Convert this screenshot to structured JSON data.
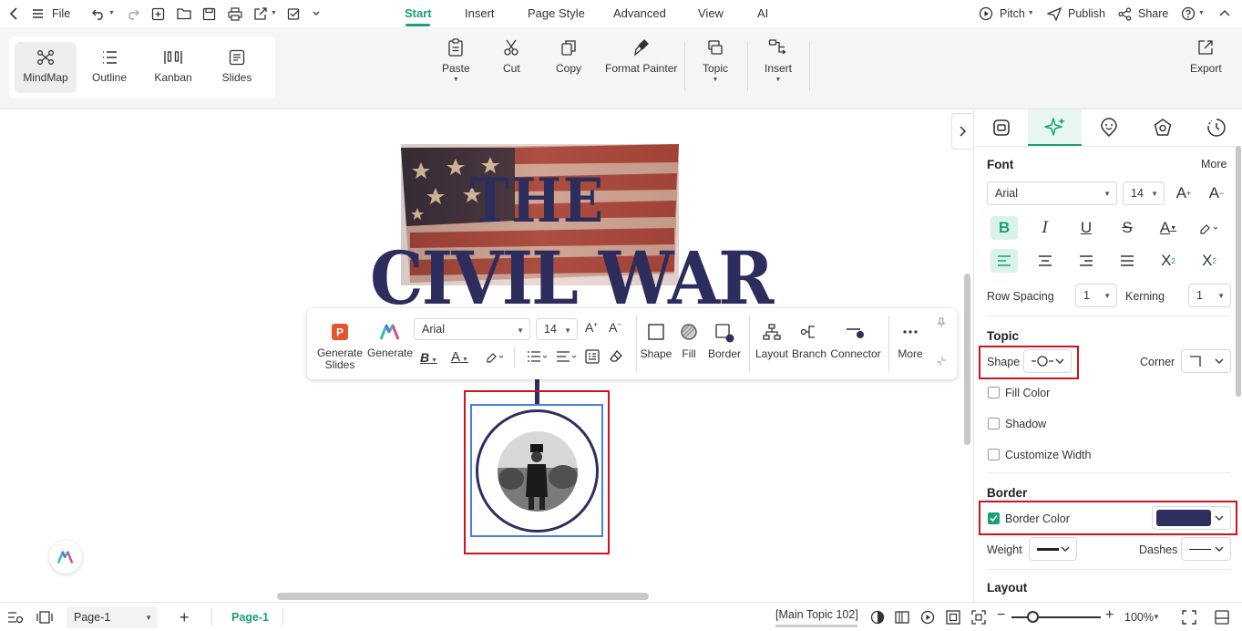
{
  "topbar": {
    "file_label": "File",
    "tabs": [
      {
        "label": "Start",
        "active": true
      },
      {
        "label": "Insert"
      },
      {
        "label": "Page Style"
      },
      {
        "label": "Advanced"
      },
      {
        "label": "View"
      },
      {
        "label": "AI"
      }
    ],
    "pitch_label": "Pitch",
    "publish_label": "Publish",
    "share_label": "Share"
  },
  "ribbon": {
    "views": [
      {
        "label": "MindMap",
        "icon": "mindmap-icon",
        "active": true
      },
      {
        "label": "Outline",
        "icon": "outline-icon"
      },
      {
        "label": "Kanban",
        "icon": "kanban-icon"
      },
      {
        "label": "Slides",
        "icon": "slides-icon"
      }
    ],
    "paste_label": "Paste",
    "cut_label": "Cut",
    "copy_label": "Copy",
    "format_painter_label": "Format Painter",
    "topic_label": "Topic",
    "insert_label": "Insert",
    "export_label": "Export"
  },
  "canvas": {
    "title_line1": "THE",
    "title_line2": "CIVIL WAR"
  },
  "floating_toolbar": {
    "generate_slides_label1": "Generate",
    "generate_slides_label2": "Slides",
    "generate_label": "Generate",
    "font": "Arial",
    "font_size": "14",
    "shape_label": "Shape",
    "fill_label": "Fill",
    "border_label": "Border",
    "layout_label": "Layout",
    "branch_label": "Branch",
    "connector_label": "Connector",
    "more_label": "More",
    "accent": "#2e2f5e"
  },
  "panel": {
    "font_title": "Font",
    "more_label": "More",
    "font_family": "Arial",
    "font_size": "14",
    "row_spacing_label": "Row Spacing",
    "row_spacing_value": "1",
    "kerning_label": "Kerning",
    "kerning_value": "1",
    "topic_title": "Topic",
    "shape_label": "Shape",
    "corner_label": "Corner",
    "fill_color_label": "Fill Color",
    "fill_color_checked": false,
    "shadow_label": "Shadow",
    "shadow_checked": false,
    "customize_width_label": "Customize Width",
    "customize_width_checked": false,
    "border_title": "Border",
    "border_color_label": "Border Color",
    "border_color_checked": true,
    "border_color": "#2e2f5e",
    "weight_label": "Weight",
    "dashes_label": "Dashes",
    "layout_title": "Layout"
  },
  "statusbar": {
    "page_select": "Page-1",
    "page_tab": "Page-1",
    "selection_info": "[Main Topic 102]",
    "zoom": "100%"
  },
  "colors": {
    "accent": "#1aa077",
    "highlight": "#d0121c",
    "selection": "#4a7fd6"
  }
}
